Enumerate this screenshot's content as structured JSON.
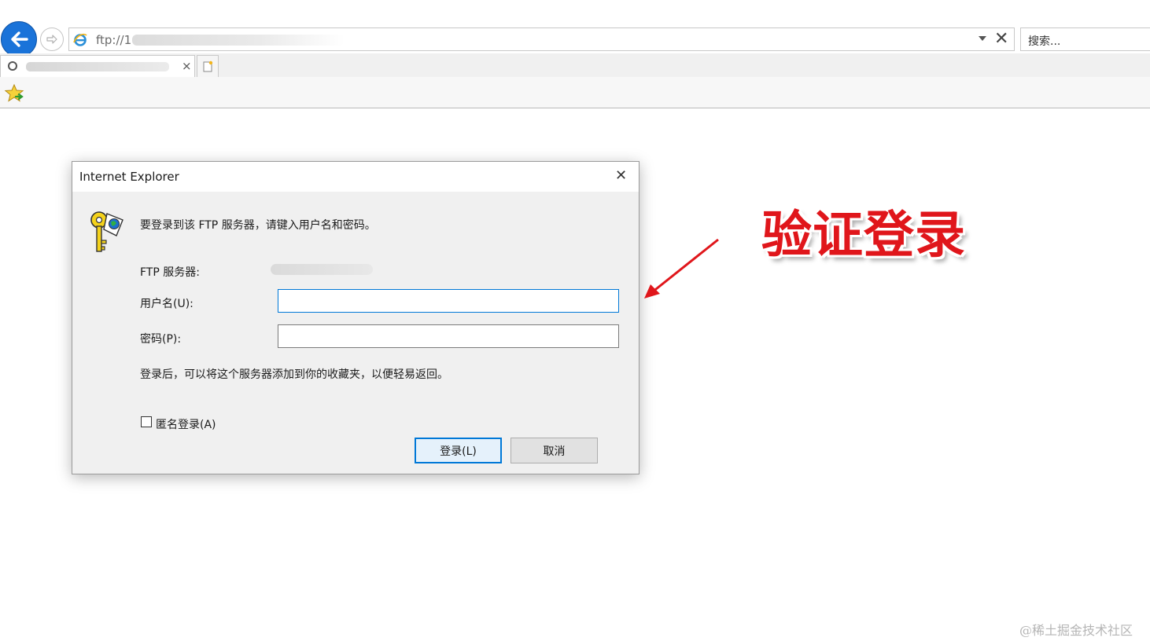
{
  "browser": {
    "address": "ftp://1",
    "search_placeholder": "搜索...",
    "tab_close": "×",
    "stop": "✕"
  },
  "dialog": {
    "title": "Internet Explorer",
    "close": "✕",
    "prompt": "要登录到该 FTP 服务器，请键入用户名和密码。",
    "server_label": "FTP 服务器:",
    "username_label": "用户名(U):",
    "password_label": "密码(P):",
    "username_value": "",
    "password_value": "",
    "note": "登录后，可以将这个服务器添加到你的收藏夹，以便轻易返回。",
    "anonymous_label": "匿名登录(A)",
    "anonymous_checked": false,
    "login_button": "登录(L)",
    "cancel_button": "取消"
  },
  "annotation": {
    "text": "验证登录",
    "color": "#e0161b"
  },
  "watermark": "@稀土掘金技术社区",
  "icons": {
    "back": "back-arrow-icon",
    "forward": "forward-arrow-icon",
    "page": "ie-page-icon",
    "key": "ftp-key-icon",
    "favorites": "favorites-star-icon"
  }
}
